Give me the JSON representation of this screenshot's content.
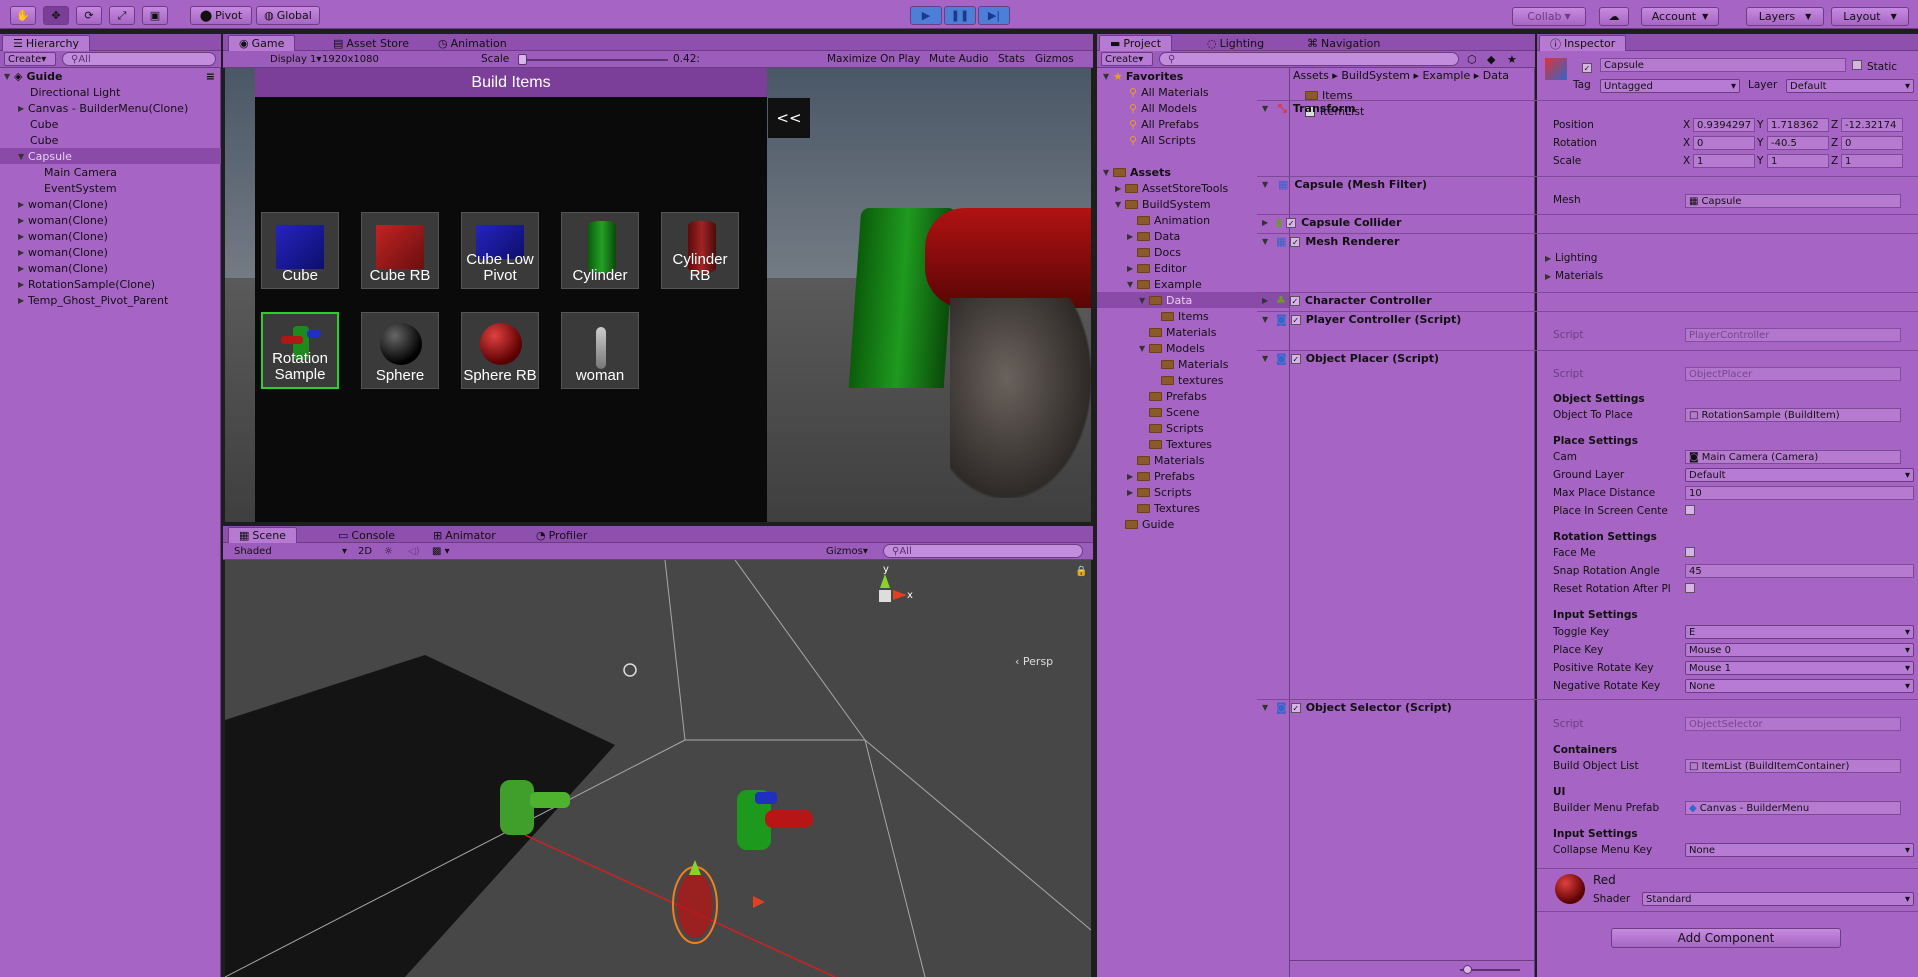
{
  "toolbar": {
    "pivot": "Pivot",
    "global": "Global",
    "collab": "Collab",
    "account": "Account",
    "layers": "Layers",
    "layout": "Layout"
  },
  "hierarchy": {
    "tab": "Hierarchy",
    "create": "Create",
    "search_placeholder": "All",
    "scene": "Guide",
    "items": [
      "Directional Light",
      "Canvas - BuilderMenu(Clone)",
      "Cube",
      "Cube",
      "Capsule",
      "Main Camera",
      "EventSystem",
      "woman(Clone)",
      "woman(Clone)",
      "woman(Clone)",
      "woman(Clone)",
      "woman(Clone)",
      "RotationSample(Clone)",
      "Temp_Ghost_Pivot_Parent"
    ]
  },
  "game": {
    "tabs": [
      "Game",
      "Asset Store",
      "Animation"
    ],
    "display": "Display 1",
    "resolution": "1920x1080",
    "scale_label": "Scale",
    "scale_value": "0.42:",
    "maximize": "Maximize On Play",
    "mute": "Mute Audio",
    "stats": "Stats",
    "gizmos": "Gizmos",
    "build_title": "Build Items",
    "collapse": "<<",
    "items": [
      "Cube",
      "Cube RB",
      "Cube Low Pivot",
      "Cylinder",
      "Cylinder RB",
      "Rotation Sample",
      "Sphere",
      "Sphere RB",
      "woman"
    ]
  },
  "scene": {
    "tabs": [
      "Scene",
      "Console",
      "Animator",
      "Profiler"
    ],
    "shaded": "Shaded",
    "mode_2d": "2D",
    "gizmos": "Gizmos",
    "search_placeholder": "All",
    "persp": "Persp",
    "axis_y": "y",
    "axis_x": "x"
  },
  "project": {
    "tabs": [
      "Project",
      "Lighting",
      "Navigation"
    ],
    "create": "Create",
    "favorites": "Favorites",
    "fav_items": [
      "All Materials",
      "All Models",
      "All Prefabs",
      "All Scripts"
    ],
    "assets": "Assets",
    "tree": [
      {
        "label": "AssetStoreTools",
        "depth": 1,
        "arrow": "▶"
      },
      {
        "label": "BuildSystem",
        "depth": 1,
        "arrow": "▼"
      },
      {
        "label": "Animation",
        "depth": 2,
        "arrow": ""
      },
      {
        "label": "Data",
        "depth": 2,
        "arrow": "▶"
      },
      {
        "label": "Docs",
        "depth": 2,
        "arrow": ""
      },
      {
        "label": "Editor",
        "depth": 2,
        "arrow": "▶"
      },
      {
        "label": "Example",
        "depth": 2,
        "arrow": "▼"
      },
      {
        "label": "Data",
        "depth": 3,
        "arrow": "▼"
      },
      {
        "label": "Items",
        "depth": 4,
        "arrow": ""
      },
      {
        "label": "Materials",
        "depth": 3,
        "arrow": ""
      },
      {
        "label": "Models",
        "depth": 3,
        "arrow": "▼"
      },
      {
        "label": "Materials",
        "depth": 4,
        "arrow": ""
      },
      {
        "label": "textures",
        "depth": 4,
        "arrow": ""
      },
      {
        "label": "Prefabs",
        "depth": 3,
        "arrow": ""
      },
      {
        "label": "Scene",
        "depth": 3,
        "arrow": ""
      },
      {
        "label": "Scripts",
        "depth": 3,
        "arrow": ""
      },
      {
        "label": "Textures",
        "depth": 3,
        "arrow": ""
      },
      {
        "label": "Materials",
        "depth": 2,
        "arrow": ""
      },
      {
        "label": "Prefabs",
        "depth": 2,
        "arrow": "▶"
      },
      {
        "label": "Scripts",
        "depth": 2,
        "arrow": "▶"
      },
      {
        "label": "Textures",
        "depth": 2,
        "arrow": ""
      },
      {
        "label": "Guide",
        "depth": 1,
        "arrow": ""
      }
    ],
    "breadcrumb": [
      "Assets",
      "BuildSystem",
      "Example",
      "Data"
    ],
    "files": [
      "Items",
      "ItemList"
    ]
  },
  "inspector": {
    "tab": "Inspector",
    "name": "Capsule",
    "static": "Static",
    "tag_label": "Tag",
    "tag": "Untagged",
    "layer_label": "Layer",
    "layer": "Default",
    "transform": "Transform",
    "position_label": "Position",
    "rotation_label": "Rotation",
    "scale_label": "Scale",
    "position": [
      "0.9394297",
      "1.718362",
      "-12.32174"
    ],
    "rotation": [
      "0",
      "-40.5",
      "0"
    ],
    "scale": [
      "1",
      "1",
      "1"
    ],
    "mesh_filter": "Capsule (Mesh Filter)",
    "mesh_label": "Mesh",
    "mesh": "Capsule",
    "capsule_collider": "Capsule Collider",
    "mesh_renderer": "Mesh Renderer",
    "lighting": "Lighting",
    "materials": "Materials",
    "character_controller": "Character Controller",
    "player_controller": "Player Controller (Script)",
    "script_label": "Script",
    "player_script": "PlayerController",
    "object_placer": "Object Placer (Script)",
    "placer_script": "ObjectPlacer",
    "object_settings": "Object Settings",
    "object_to_place_label": "Object To Place",
    "object_to_place": "RotationSample (BuildItem)",
    "place_settings": "Place Settings",
    "cam_label": "Cam",
    "cam": "Main Camera (Camera)",
    "ground_layer_label": "Ground Layer",
    "ground_layer": "Default",
    "max_place_label": "Max Place Distance",
    "max_place": "10",
    "place_center_label": "Place In Screen Cente",
    "rotation_settings": "Rotation Settings",
    "face_me_label": "Face Me",
    "snap_label": "Snap Rotation Angle",
    "snap": "45",
    "reset_label": "Reset Rotation After Pl",
    "input_settings": "Input Settings",
    "toggle_key_label": "Toggle Key",
    "toggle_key": "E",
    "place_key_label": "Place Key",
    "place_key": "Mouse 0",
    "pos_rotate_label": "Positive Rotate Key",
    "pos_rotate": "Mouse 1",
    "neg_rotate_label": "Negative Rotate Key",
    "neg_rotate": "None",
    "object_selector": "Object Selector (Script)",
    "selector_script": "ObjectSelector",
    "containers": "Containers",
    "build_list_label": "Build Object List",
    "build_list": "ItemList (BuildItemContainer)",
    "ui": "UI",
    "builder_prefab_label": "Builder Menu Prefab",
    "builder_prefab": "Canvas - BuilderMenu",
    "input_settings2": "Input Settings",
    "collapse_key_label": "Collapse Menu Key",
    "collapse_key": "None",
    "material_name": "Red",
    "shader_label": "Shader",
    "shader": "Standard",
    "add_component": "Add Component"
  }
}
